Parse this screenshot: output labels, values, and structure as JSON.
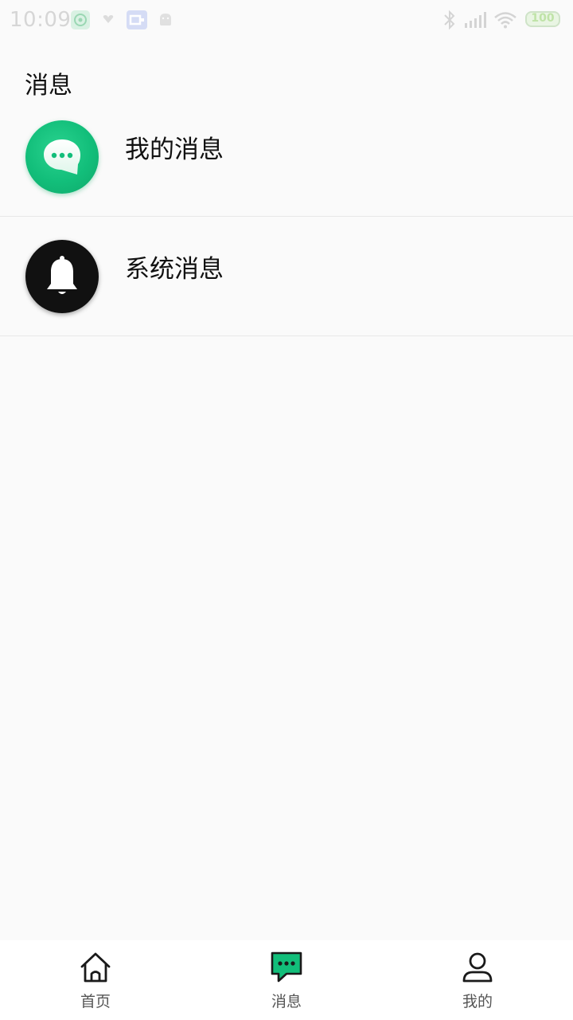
{
  "status_bar": {
    "time": "10:09",
    "battery": "100"
  },
  "page": {
    "title": "消息"
  },
  "list": {
    "items": [
      {
        "label": "我的消息",
        "icon": "chat-bubble-icon",
        "color": "#12be7a"
      },
      {
        "label": "系统消息",
        "icon": "bell-icon",
        "color": "#111111"
      }
    ]
  },
  "nav": {
    "items": [
      {
        "label": "首页",
        "icon": "home-icon"
      },
      {
        "label": "消息",
        "icon": "message-icon",
        "active": true,
        "accent": "#12be7a"
      },
      {
        "label": "我的",
        "icon": "user-icon"
      }
    ]
  }
}
